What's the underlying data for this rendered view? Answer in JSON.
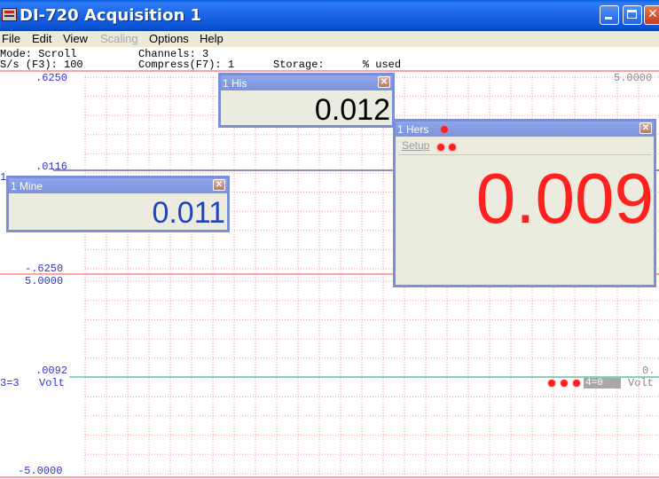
{
  "window": {
    "title": "DI-720 Acquisition 1"
  },
  "menu": [
    {
      "label": "File",
      "enabled": true
    },
    {
      "label": "Edit",
      "enabled": true
    },
    {
      "label": "View",
      "enabled": true
    },
    {
      "label": "Scaling",
      "enabled": false
    },
    {
      "label": "Options",
      "enabled": true
    },
    {
      "label": "Help",
      "enabled": true
    }
  ],
  "status": {
    "mode": "Mode: Scroll",
    "rate": "S/s (F3): 100",
    "channels": "Channels: 3",
    "compress": "Compress(F7): 1",
    "storage": "Storage:      % used"
  },
  "channel1": {
    "top": ".6250",
    "mid": ".0116",
    "bottom": "-.6250",
    "left_partial": "1",
    "right_top": "5.0000"
  },
  "channel2": {
    "top": "5.0000",
    "mid": ".0092",
    "bottom": "-5.0000",
    "label_left": "3=3",
    "unit": "Volt",
    "right_partial": "0.",
    "right_unit": "Volt",
    "marker": "4=0"
  },
  "meters": {
    "his": {
      "title": "1 His",
      "value": "0.012"
    },
    "hers": {
      "title": "1 Hers",
      "setup": "Setup",
      "value": "0.009"
    },
    "mine": {
      "title": "1 Mine",
      "value": "0.011"
    }
  },
  "colors": {
    "grid": "#ff9a9a",
    "channel1_trace": "#222266",
    "channel2_trace": "#22aa88",
    "hers_value": "#ff2020",
    "mine_value": "#2244bb",
    "scale_text": "#3333cc"
  }
}
